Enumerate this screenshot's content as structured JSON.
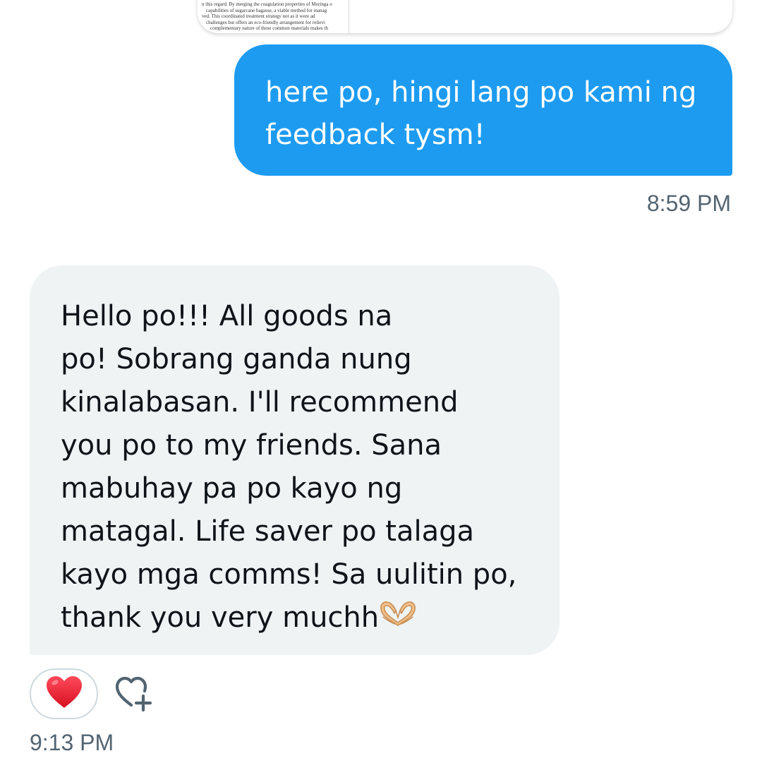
{
  "attachment": {
    "doc_preview_lines": [
      "n this regard. By merging the coagulation properties of Moringa o",
      "capabilities of sugarcane bagasse, a viable method for manag",
      "ved. This coordinated treatment strategy not as it were ad",
      "challenges but offers an eco-friendly arrangement for relievi",
      "complementary nature of these common materials makes th"
    ]
  },
  "messages": {
    "sent": {
      "lines": [
        "here po, hingi lang po kami ng",
        "feedback tysm!"
      ],
      "timestamp": "8:59 PM",
      "bubble_color": "#1d9bf0"
    },
    "received": {
      "lines": [
        "Hello po!!! All goods na",
        "po! Sobrang ganda nung",
        "kinalabasan. I'll recommend",
        "you po to my friends. Sana",
        "mabuhay pa po kayo ng",
        "matagal. Life saver po talaga",
        "kayo mga comms! Sa uulitin po,",
        "thank you very muchh"
      ],
      "emoji": "heart-hands",
      "timestamp": "9:13 PM",
      "bubble_color": "#eff3f4",
      "reactions": {
        "current": "red-heart",
        "add_reaction_icon": "heart-plus-icon"
      }
    }
  }
}
